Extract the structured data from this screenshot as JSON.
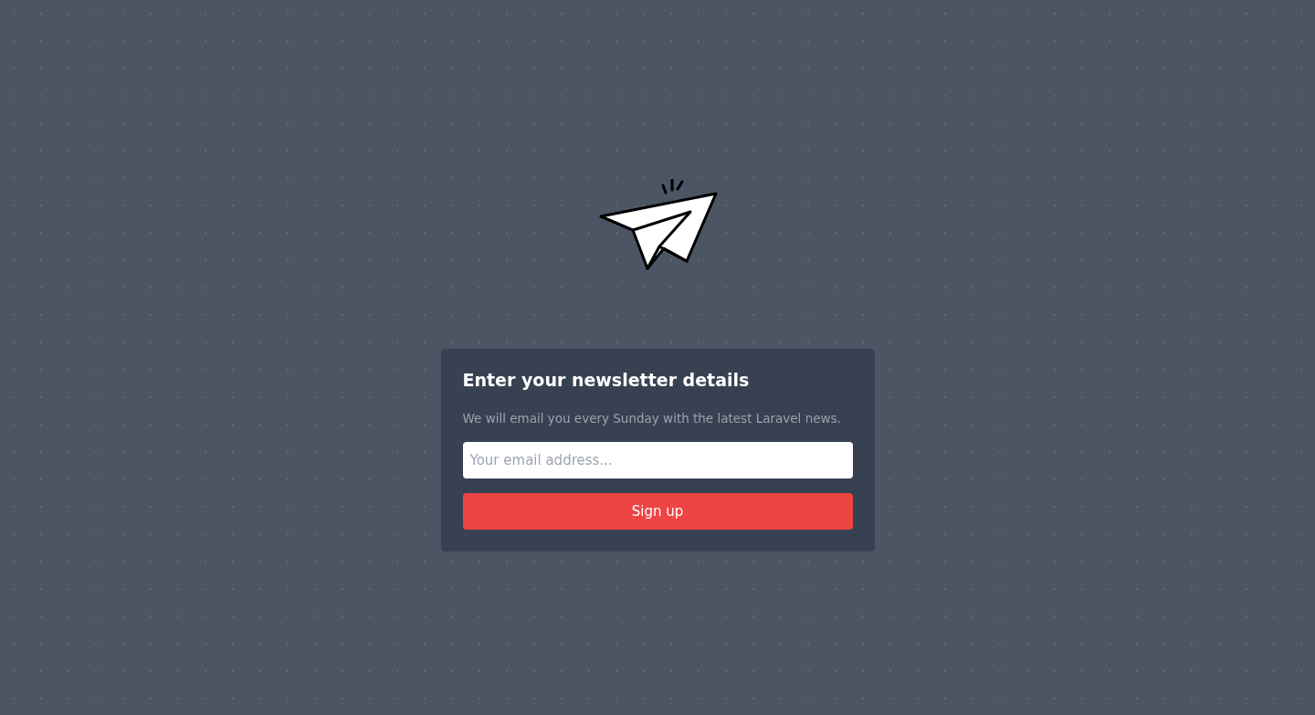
{
  "card": {
    "title": "Enter your newsletter details",
    "description": "We will email you every Sunday with the latest Laravel news.",
    "email_field": {
      "placeholder": "Your email address..."
    },
    "submit_button": {
      "label": "Sign up"
    }
  }
}
